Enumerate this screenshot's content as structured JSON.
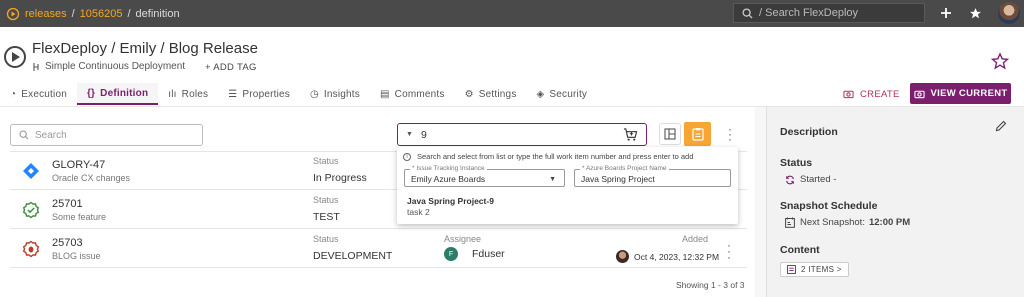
{
  "breadcrumb": {
    "root": "releases",
    "sep1": "/",
    "id": "1056205",
    "sep2": "/",
    "current": "definition"
  },
  "top_search": {
    "placeholder": "/ Search FlexDeploy"
  },
  "header": {
    "title": "FlexDeploy / Emily / Blog Release",
    "subtitle": "Simple Continuous Deployment",
    "add_tag": "+ ADD TAG"
  },
  "tabs": [
    {
      "label": "Execution",
      "icon": "execution-icon"
    },
    {
      "label": "Definition",
      "icon": "code-icon"
    },
    {
      "label": "Roles",
      "icon": "roles-icon"
    },
    {
      "label": "Properties",
      "icon": "list-icon"
    },
    {
      "label": "Insights",
      "icon": "insights-icon"
    },
    {
      "label": "Comments",
      "icon": "comment-icon"
    },
    {
      "label": "Settings",
      "icon": "gear-icon"
    },
    {
      "label": "Security",
      "icon": "shield-icon"
    }
  ],
  "actions": {
    "create": "CREATE",
    "view_current": "VIEW CURRENT"
  },
  "search": {
    "placeholder": "Search"
  },
  "work_item_input": {
    "value": "9"
  },
  "popup": {
    "hint": "Search and select from list or type the full work item number and press enter to add",
    "tracking_label": "* Issue Tracking Instance",
    "tracking_value": "Emily Azure Boards",
    "project_label": "* Azure Boards Project Name",
    "project_value": "Java Spring Project",
    "result_title": "Java Spring Project-9",
    "result_sub": "task 2"
  },
  "rows": [
    {
      "id": "GLORY-47",
      "desc": "Oracle CX changes",
      "status_label": "Status",
      "status": "In Progress",
      "icon": "jira-icon"
    },
    {
      "id": "25701",
      "desc": "Some feature",
      "status_label": "Status",
      "status": "TEST",
      "icon": "check-circle-icon"
    },
    {
      "id": "25703",
      "desc": "BLOG issue",
      "status_label": "Status",
      "status": "DEVELOPMENT",
      "assignee_label": "Assignee",
      "assignee": "Fduser",
      "assignee_initial": "F",
      "added_label": "Added",
      "added": "Oct 4, 2023, 12:32 PM",
      "icon": "bug-icon"
    }
  ],
  "showing": "Showing 1 - 3 of 3",
  "side": {
    "description_h": "Description",
    "status_h": "Status",
    "status_v": "Started -",
    "schedule_h": "Snapshot Schedule",
    "schedule_label": "Next Snapshot:",
    "schedule_time": "12:00 PM",
    "content_h": "Content",
    "items": "2 ITEMS >"
  },
  "colors": {
    "brand": "#7b1e6e",
    "accent": "#f5a623",
    "topbar": "#4a4a4a"
  }
}
